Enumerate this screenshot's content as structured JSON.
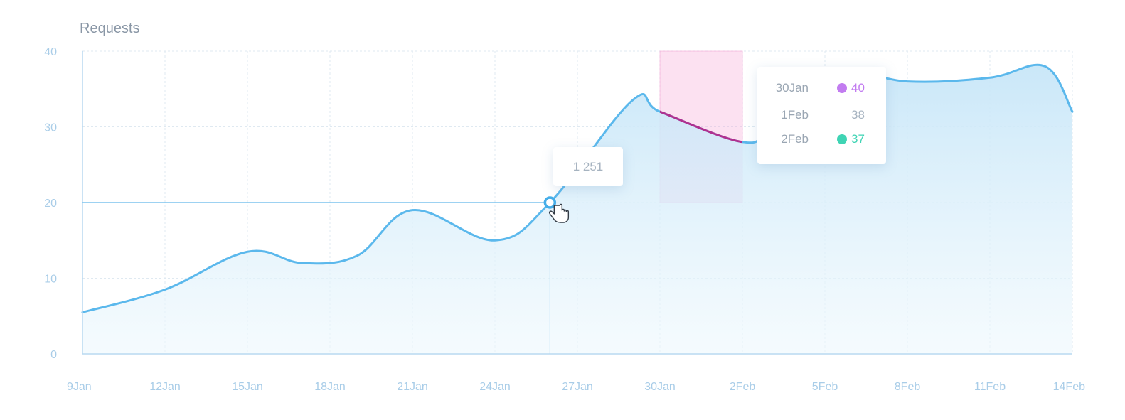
{
  "chart_data": {
    "type": "area",
    "title": "Requests",
    "y_ticks": [
      "0",
      "10",
      "20",
      "30",
      "40"
    ],
    "x_ticks": [
      "9Jan",
      "12Jan",
      "15Jan",
      "18Jan",
      "21Jan",
      "24Jan",
      "27Jan",
      "30Jan",
      "2Feb",
      "5Feb",
      "8Feb",
      "11Feb",
      "14Feb"
    ],
    "ylim": [
      0,
      40
    ],
    "grid": true,
    "series": [
      {
        "x": [
          "9Jan",
          "12Jan",
          "15Jan",
          "17Jan",
          "19Jan",
          "21Jan",
          "24Jan",
          "26Jan",
          "29Jan",
          "30Jan",
          "2Feb",
          "3Feb",
          "5Feb",
          "8Feb",
          "11Feb",
          "13Feb",
          "14Feb"
        ],
        "values": [
          5.5,
          8.5,
          13.5,
          12.0,
          13.0,
          19.0,
          15.0,
          20.0,
          33.5,
          32.0,
          28.0,
          30.0,
          37.5,
          36.0,
          36.5,
          38.0,
          32.0
        ]
      }
    ],
    "crosshair": {
      "x": "26Jan",
      "y": 20
    },
    "highlight_range": {
      "x_start": "30Jan",
      "x_end": "2Feb",
      "y_min": 20,
      "y_max": 40
    },
    "tooltip_point": {
      "value": "1 251"
    },
    "tooltip_range": {
      "rows": [
        {
          "date": "30Jan",
          "value": "40",
          "color": "#c27cf0"
        },
        {
          "date": "1Feb",
          "value": "38",
          "color": ""
        },
        {
          "date": "2Feb",
          "value": "37",
          "color": "#3fd4b4"
        }
      ]
    },
    "colors": {
      "line": "#5bb8ec",
      "highlight": "#f5a9d6",
      "highlight_line": "#b0308f",
      "area": "#bde3f7"
    }
  }
}
